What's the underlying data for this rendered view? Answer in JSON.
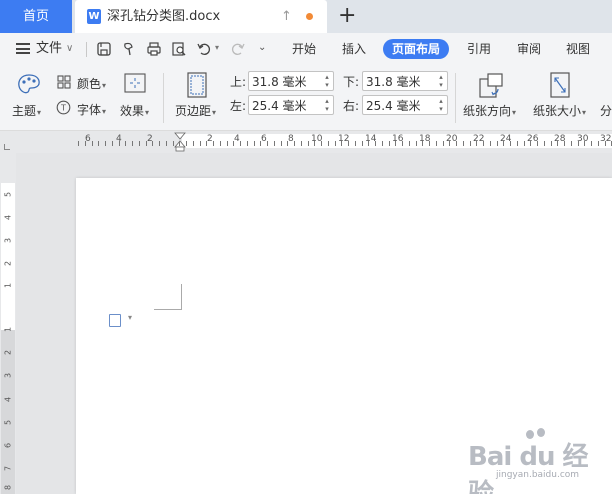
{
  "tabs": {
    "home": "首页",
    "document": "深孔钻分类图.docx"
  },
  "menu": {
    "file": "文件",
    "tabs": [
      {
        "label": "开始",
        "active": false
      },
      {
        "label": "插入",
        "active": false
      },
      {
        "label": "页面布局",
        "active": true
      },
      {
        "label": "引用",
        "active": false
      },
      {
        "label": "审阅",
        "active": false
      },
      {
        "label": "视图",
        "active": false
      }
    ]
  },
  "ribbon": {
    "theme": "主题",
    "color": "颜色",
    "font": "字体",
    "effect": "效果",
    "margins": "页边距",
    "margin_top_label": "上:",
    "margin_top_value": "31.8 毫米",
    "margin_bottom_label": "下:",
    "margin_bottom_value": "31.8 毫米",
    "margin_left_label": "左:",
    "margin_left_value": "25.4 毫米",
    "margin_right_label": "右:",
    "margin_right_value": "25.4 毫米",
    "orientation": "纸张方向",
    "size": "纸张大小",
    "columns": "分"
  },
  "ruler": {
    "numbers": [
      "6",
      "4",
      "2",
      "2",
      "4",
      "6",
      "8",
      "10",
      "12",
      "14",
      "16",
      "18",
      "20",
      "22",
      "24",
      "26",
      "28",
      "30",
      "32"
    ]
  },
  "vruler": {
    "numbers": [
      "5",
      "4",
      "3",
      "2",
      "1",
      "1",
      "2",
      "3",
      "4",
      "5",
      "6",
      "7",
      "8"
    ]
  },
  "watermark": {
    "text": "Bai du 经验",
    "url": "jingyan.baidu.com"
  },
  "colors": {
    "accent": "#3d7cf2",
    "modified_dot": "#f28a36"
  }
}
